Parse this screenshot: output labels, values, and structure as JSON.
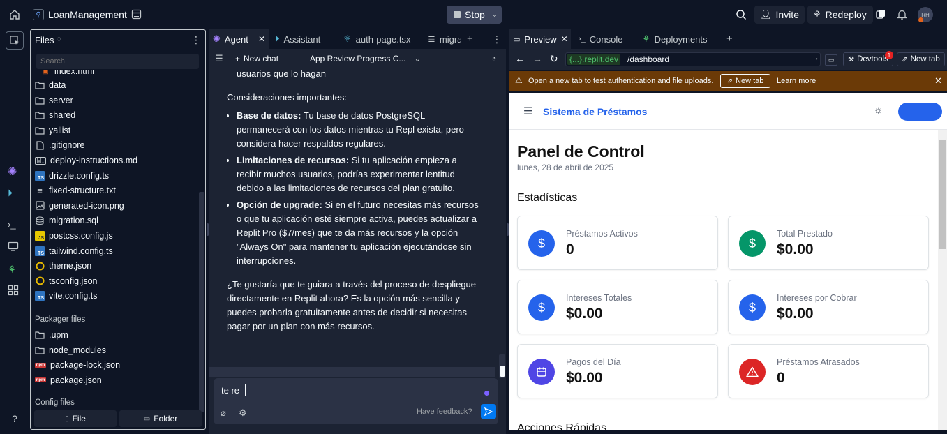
{
  "topbar": {
    "project_name": "LoanManagement",
    "stop_label": "Stop",
    "invite_label": "Invite",
    "redeploy_label": "Redeploy",
    "avatar_initials": "RH"
  },
  "files": {
    "title": "Files",
    "search_placeholder": "Search",
    "partial_top": "index.html",
    "items": [
      {
        "name": "data",
        "icon": "folder-icon"
      },
      {
        "name": "server",
        "icon": "folder-icon"
      },
      {
        "name": "shared",
        "icon": "folder-icon"
      },
      {
        "name": "yallist",
        "icon": "folder-icon"
      },
      {
        "name": ".gitignore",
        "icon": "file-icon"
      },
      {
        "name": "deploy-instructions.md",
        "icon": "markdown-icon"
      },
      {
        "name": "drizzle.config.ts",
        "icon": "ts-icon"
      },
      {
        "name": "fixed-structure.txt",
        "icon": "text-file-icon"
      },
      {
        "name": "generated-icon.png",
        "icon": "image-icon"
      },
      {
        "name": "migration.sql",
        "icon": "database-icon"
      },
      {
        "name": "postcss.config.js",
        "icon": "js-icon"
      },
      {
        "name": "tailwind.config.ts",
        "icon": "ts-icon"
      },
      {
        "name": "theme.json",
        "icon": "json-icon"
      },
      {
        "name": "tsconfig.json",
        "icon": "json-icon"
      },
      {
        "name": "vite.config.ts",
        "icon": "ts-icon"
      }
    ],
    "packager_title": "Packager files",
    "packager_items": [
      {
        "name": ".upm",
        "icon": "folder-icon"
      },
      {
        "name": "node_modules",
        "icon": "folder-icon"
      },
      {
        "name": "package-lock.json",
        "icon": "npm-icon"
      },
      {
        "name": "package.json",
        "icon": "npm-icon"
      }
    ],
    "config_title": "Config files",
    "file_button": "File",
    "folder_button": "Folder"
  },
  "agent": {
    "tabs": [
      "Agent",
      "Assistant",
      "auth-page.tsx",
      "migra"
    ],
    "new_chat": "New chat",
    "conversation_title": "App Review Progress C...",
    "chat": {
      "line0": "usuarios que lo hagan",
      "heading": "Consideraciones importantes:",
      "b1_title": "Base de datos:",
      "b1_text": " Tu base de datos PostgreSQL permanecerá con los datos mientras tu Repl exista, pero considera hacer respaldos regulares.",
      "b2_title": "Limitaciones de recursos:",
      "b2_text": " Si tu aplicación empieza a recibir muchos usuarios, podrías experimentar lentitud debido a las limitaciones de recursos del plan gratuito.",
      "b3_title": "Opción de upgrade:",
      "b3_text": " Si en el futuro necesitas más recursos o que tu aplicación esté siempre activa, puedes actualizar a Replit Pro ($7/mes) que te da más recursos y la opción \"Always On\" para mantener tu aplicación ejecutándose sin interrupciones.",
      "closing": "¿Te gustaría que te guiara a través del proceso de despliegue directamente en Replit ahora? Es la opción más sencilla y puedes probarla gratuitamente antes de decidir si necesitas pagar por un plan con más recursos."
    },
    "input_value": "te re",
    "feedback": "Have feedback?"
  },
  "preview": {
    "tabs": [
      "Preview",
      "Console",
      "Deployments"
    ],
    "url_domain": "{...}.replit.dev",
    "url_path": "/dashboard",
    "devtools_label": "Devtools",
    "devtools_badge": "1",
    "new_tab_label": "New tab",
    "banner_text": "Open a new tab to test authentication and file uploads.",
    "banner_button": "New tab",
    "banner_link": "Learn more",
    "app": {
      "brand": "Sistema de Préstamos",
      "title": "Panel de Control",
      "date": "lunes, 28 de abril de 2025",
      "stats_title": "Estadísticas",
      "cards": [
        {
          "label": "Préstamos Activos",
          "value": "0",
          "color": "#2563eb",
          "icon": "dollar-icon"
        },
        {
          "label": "Total Prestado",
          "value": "$0.00",
          "color": "#059669",
          "icon": "dollar-icon"
        },
        {
          "label": "Intereses Totales",
          "value": "$0.00",
          "color": "#2563eb",
          "icon": "dollar-icon"
        },
        {
          "label": "Intereses por Cobrar",
          "value": "$0.00",
          "color": "#2563eb",
          "icon": "dollar-icon"
        },
        {
          "label": "Pagos del Día",
          "value": "$0.00",
          "color": "#4f46e5",
          "icon": "calendar-icon"
        },
        {
          "label": "Préstamos Atrasados",
          "value": "0",
          "color": "#dc2626",
          "icon": "alert-icon"
        }
      ],
      "quick_actions": "Acciones Rápidas"
    }
  }
}
